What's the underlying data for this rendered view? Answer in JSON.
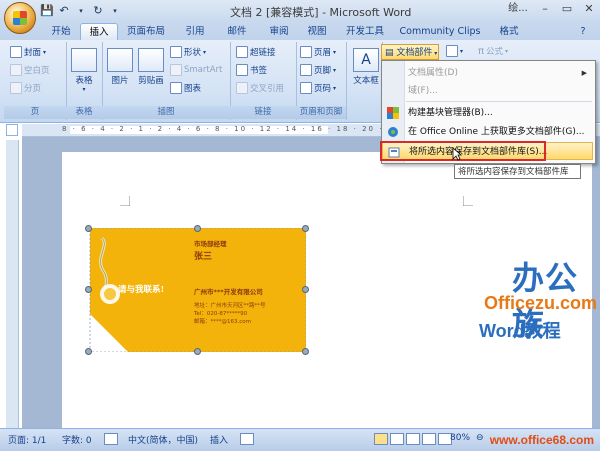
{
  "window": {
    "title": "文档 2 [兼容模式] - Microsoft Word",
    "extra": "绘..."
  },
  "tabs": [
    "开始",
    "插入",
    "页面布局",
    "引用",
    "邮件",
    "审阅",
    "视图",
    "开发工具",
    "Community Clips",
    "格式"
  ],
  "active_tab": "插入",
  "ribbon": {
    "pages": {
      "cover": "封面",
      "blank": "空白页",
      "break": "分页",
      "label": "页"
    },
    "tables": {
      "table": "表格",
      "label": "表格"
    },
    "illustrations": {
      "picture": "图片",
      "clipart": "剪贴画",
      "shapes": "形状",
      "smartart": "SmartArt",
      "chart": "图表",
      "label": "插图"
    },
    "links": {
      "hyperlink": "超链接",
      "bookmark": "书签",
      "crossref": "交叉引用",
      "label": "链接"
    },
    "headerfooter": {
      "header": "页眉",
      "footer": "页脚",
      "pagenum": "页码",
      "label": "页眉和页脚"
    },
    "text": {
      "textbox": "文本框",
      "docparts": "文档部件",
      "formula": "公式"
    }
  },
  "menu": {
    "items": [
      {
        "label": "文档属性(D)",
        "disabled": true,
        "submenu": true
      },
      {
        "label": "域(F)...",
        "disabled": true,
        "submenu": false
      },
      {
        "label": "构建基块管理器(B)...",
        "disabled": false,
        "submenu": false
      },
      {
        "label": "在 Office Online 上获取更多文档部件(G)...",
        "disabled": false,
        "submenu": false
      },
      {
        "label": "将所选内容保存到文档部件库(S)...",
        "disabled": false,
        "submenu": false,
        "highlighted": true
      }
    ],
    "tooltip": "将所选内容保存到文档部件库"
  },
  "ruler": "8 · 6 · 4 · 2 · 1 · 2 · 4 · 6 · 8 · 10 · 12 · 14 · 16 · 18 · 20 · 22 · 24 · 26",
  "card": {
    "department": "市场部经理",
    "name": "张三",
    "contact_cta": "请与我联系!",
    "company": "广州市***开发有限公司",
    "address": "地址：广州市天河区**路**号",
    "tel": "Tel：020-87*****90",
    "email": "邮箱：****@163.com",
    "color": "#f4b30a"
  },
  "watermark": {
    "title": "办公族",
    "url": "Officezu.com",
    "subtitle": "Word教程"
  },
  "statusbar": {
    "page": "页面: 1/1",
    "words": "字数: 0",
    "lang": "中文(简体，中国)",
    "mode": "插入",
    "zoom": "80%",
    "site": "www.office68.com"
  }
}
